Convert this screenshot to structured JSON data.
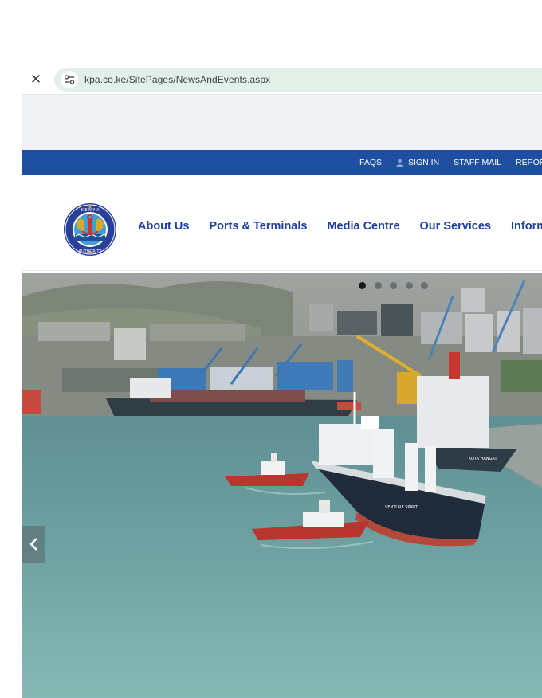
{
  "browser": {
    "url": "kpa.co.ke/SitePages/NewsAndEvents.aspx",
    "close_icon": "close-icon",
    "site_info_icon": "tune-icon"
  },
  "top_bar": {
    "bg_color": "#1f4fa3",
    "links": [
      {
        "label": "FAQS"
      },
      {
        "label": "SIGN IN",
        "icon": "user-icon"
      },
      {
        "label": "STAFF MAIL"
      },
      {
        "label": "REPORT CO"
      }
    ]
  },
  "header": {
    "logo_text": "KENYA PORTS AUTHORITY",
    "nav": [
      {
        "label": "About Us"
      },
      {
        "label": "Ports & Terminals"
      },
      {
        "label": "Media Centre"
      },
      {
        "label": "Our Services"
      },
      {
        "label": "Inform"
      }
    ],
    "nav_color": "#1f3fa8"
  },
  "hero": {
    "slides_count": 5,
    "active_slide": 1,
    "prev_icon": "chevron-left-icon",
    "ship_names": [
      "VENTURE SPIRIT",
      "KOTA HANGAT"
    ]
  }
}
